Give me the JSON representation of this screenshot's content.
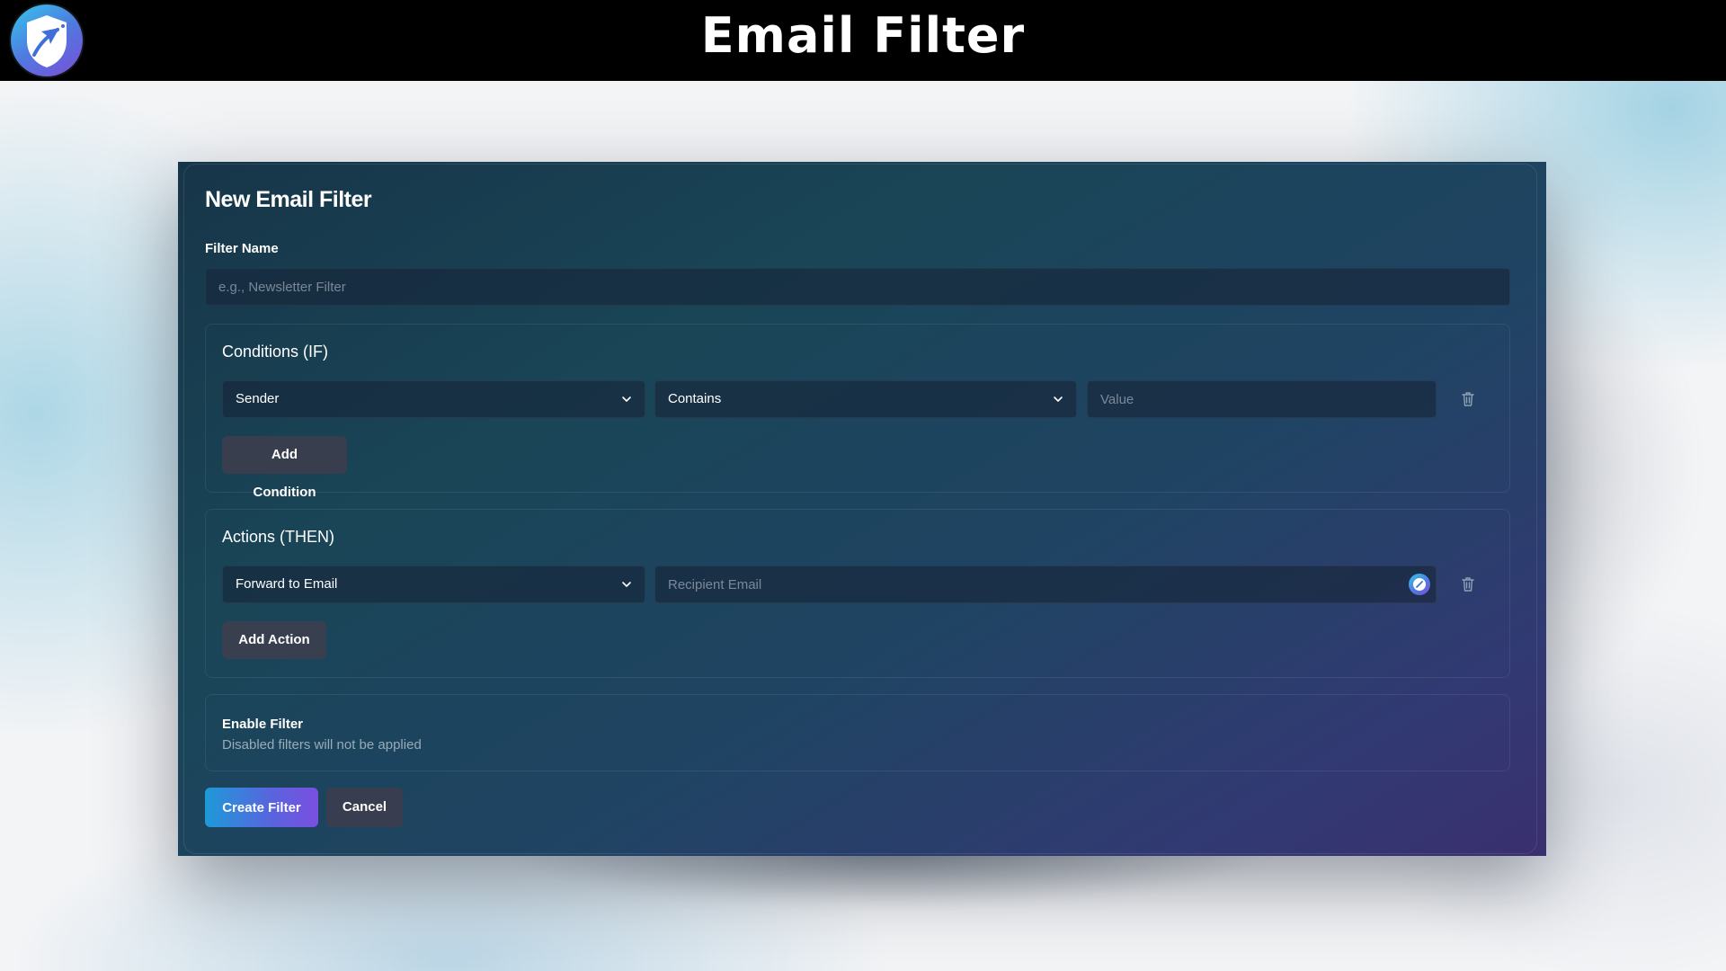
{
  "header": {
    "title": "Email Filter",
    "logo_icon": "shield-paper-plane-logo"
  },
  "form": {
    "title": "New Email Filter",
    "filter_name": {
      "label": "Filter Name",
      "value": "",
      "placeholder": "e.g., Newsletter Filter"
    },
    "conditions": {
      "title": "Conditions (IF)",
      "field_select": "Sender",
      "operator_select": "Contains",
      "value_input": {
        "value": "",
        "placeholder": "Value"
      },
      "delete_icon": "trash-icon",
      "add_label": "Add Condition"
    },
    "actions": {
      "title": "Actions (THEN)",
      "action_select": "Forward to Email",
      "recipient_input": {
        "value": "",
        "placeholder": "Recipient Email"
      },
      "delete_icon": "trash-icon",
      "add_label": "Add Action"
    },
    "enable": {
      "title": "Enable Filter",
      "subtitle": "Disabled filters will not be applied"
    },
    "buttons": {
      "create": "Create Filter",
      "cancel": "Cancel"
    }
  },
  "colors": {
    "header_bg": "#000000",
    "accent_start": "#1e9ad8",
    "accent_end": "#7a4fe0",
    "card_bg_start": "#173549",
    "card_bg_end": "#3a2f70"
  }
}
